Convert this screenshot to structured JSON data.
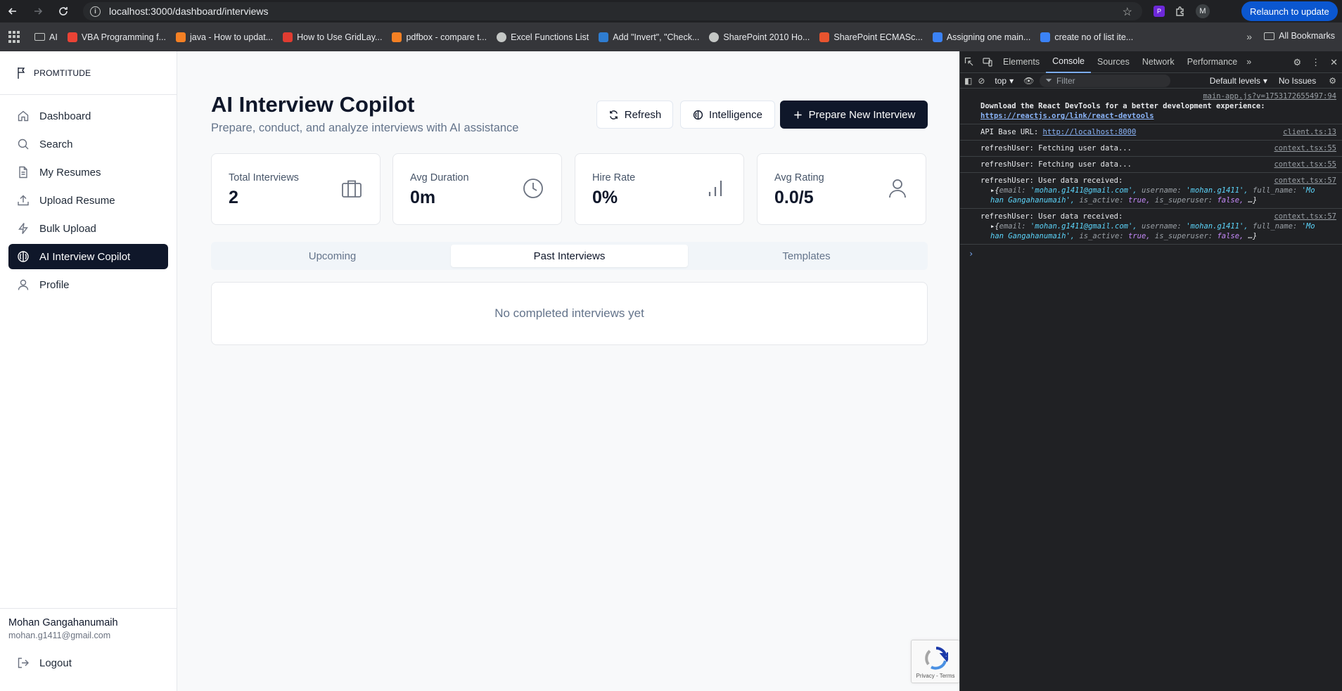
{
  "browser": {
    "url": "localhost:3000/dashboard/interviews",
    "relaunch_label": "Relaunch to update",
    "profile_initial": "M",
    "bookmarks": [
      {
        "label": "AI",
        "icon": "folder-icon",
        "color": "#c4c7c5"
      },
      {
        "label": "VBA Programming f...",
        "icon": "google-icon",
        "color": "#ea4335"
      },
      {
        "label": "java - How to updat...",
        "icon": "stackoverflow-icon",
        "color": "#f48024"
      },
      {
        "label": "How to Use GridLay...",
        "icon": "oracle-icon",
        "color": "#e03c31"
      },
      {
        "label": "pdfbox - compare t...",
        "icon": "stackoverflow-icon",
        "color": "#f48024"
      },
      {
        "label": "Excel Functions List",
        "icon": "globe-icon",
        "color": "#c4c7c5"
      },
      {
        "label": "Add \"Invert\", \"Check...",
        "icon": "microsoft-icon",
        "color": "#2f7dd1"
      },
      {
        "label": "SharePoint 2010 Ho...",
        "icon": "globe-icon",
        "color": "#c4c7c5"
      },
      {
        "label": "SharePoint ECMASc...",
        "icon": "site-icon",
        "color": "#e8542f"
      },
      {
        "label": "Assigning one main...",
        "icon": "azure-icon",
        "color": "#3b82f6"
      },
      {
        "label": "create no of list ite...",
        "icon": "azure-icon",
        "color": "#3b82f6"
      }
    ],
    "all_bookmarks_label": "All Bookmarks"
  },
  "sidebar": {
    "brand": "PROMTITUDE",
    "items": [
      {
        "label": "Dashboard",
        "icon": "home-icon",
        "active": false
      },
      {
        "label": "Search",
        "icon": "search-icon",
        "active": false
      },
      {
        "label": "My Resumes",
        "icon": "document-icon",
        "active": false
      },
      {
        "label": "Upload Resume",
        "icon": "upload-icon",
        "active": false
      },
      {
        "label": "Bulk Upload",
        "icon": "lightning-icon",
        "active": false
      },
      {
        "label": "AI Interview Copilot",
        "icon": "brain-icon",
        "active": true
      },
      {
        "label": "Profile",
        "icon": "user-icon",
        "active": false
      }
    ],
    "user": {
      "name": "Mohan Gangahanumaih",
      "email": "mohan.g1411@gmail.com"
    },
    "logout_label": "Logout"
  },
  "main": {
    "title": "AI Interview Copilot",
    "subtitle": "Prepare, conduct, and analyze interviews with AI assistance",
    "buttons": {
      "refresh": "Refresh",
      "intelligence": "Intelligence",
      "prepare": "Prepare New Interview"
    },
    "stats": [
      {
        "label": "Total Interviews",
        "value": "2",
        "icon": "briefcase-icon"
      },
      {
        "label": "Avg Duration",
        "value": "0m",
        "icon": "clock-icon"
      },
      {
        "label": "Hire Rate",
        "value": "0%",
        "icon": "bar-chart-icon"
      },
      {
        "label": "Avg Rating",
        "value": "0.0/5",
        "icon": "user-icon"
      }
    ],
    "tabs": [
      {
        "label": "Upcoming",
        "active": false
      },
      {
        "label": "Past Interviews",
        "active": true
      },
      {
        "label": "Templates",
        "active": false
      }
    ],
    "empty_message": "No completed interviews yet",
    "recaptcha_text": "Privacy - Terms"
  },
  "devtools": {
    "tabs": [
      "Elements",
      "Console",
      "Sources",
      "Network",
      "Performance"
    ],
    "active_tab": "Console",
    "context": "top",
    "filter_placeholder": "Filter",
    "levels": "Default levels",
    "issues": "No Issues",
    "logs": {
      "l0_src": "main-app.js?v=1753172655497:94",
      "l0_text": "Download the React DevTools for a better development experience:",
      "l0_link": "https://reactjs.org/link/react-devtools",
      "l1_text": "API Base URL:",
      "l1_link": "http://localhost:8000",
      "l1_src": "client.ts:13",
      "l2_text": "refreshUser: Fetching user data...",
      "l2_src": "context.tsx:55",
      "l3_text": "refreshUser: Fetching user data...",
      "l3_src": "context.tsx:55",
      "l4_text": "refreshUser: User data received:",
      "l4_src": "context.tsx:57",
      "l5_text": "refreshUser: User data received:",
      "l5_src": "context.tsx:57",
      "obj": {
        "email_key": "email:",
        "email_val": "'mohan.g1411@gmail.com',",
        "username_key": "username:",
        "username_val": "'mohan.g1411',",
        "fullname_key": "full_name:",
        "fullname_val": "'Mo",
        "fullname_val2": "han Gangahanumaih',",
        "active_key": "is_active:",
        "active_val": "true,",
        "super_key": "is_superuser:",
        "super_val": "false,",
        "rest": "…}"
      }
    }
  }
}
